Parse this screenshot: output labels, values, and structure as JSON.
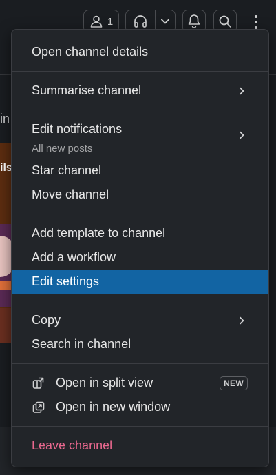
{
  "header": {
    "member_count": "1"
  },
  "background": {
    "fragment_text": "in",
    "card_label": "ils"
  },
  "menu": {
    "open_details": "Open channel details",
    "summarise": "Summarise channel",
    "edit_notifications": "Edit notifications",
    "notifications_sub": "All new posts",
    "star": "Star channel",
    "move": "Move channel",
    "add_template": "Add template to channel",
    "add_workflow": "Add a workflow",
    "edit_settings": "Edit settings",
    "copy": "Copy",
    "search_in_channel": "Search in channel",
    "open_split": "Open in split view",
    "new_badge": "NEW",
    "open_new_window": "Open in new window",
    "leave": "Leave channel"
  },
  "colors": {
    "menu_bg": "#222529",
    "highlight": "#1264a3",
    "danger": "#e8688e",
    "text": "#e8e8e8"
  },
  "icons": {
    "members": "person-icon",
    "huddle": "headphones-icon",
    "huddle_dropdown": "chevron-down-icon",
    "notifications": "bell-icon",
    "search": "search-icon",
    "more": "kebab-icon",
    "split_view": "split-view-icon",
    "new_window": "new-window-icon",
    "submenu": "chevron-right-icon"
  }
}
